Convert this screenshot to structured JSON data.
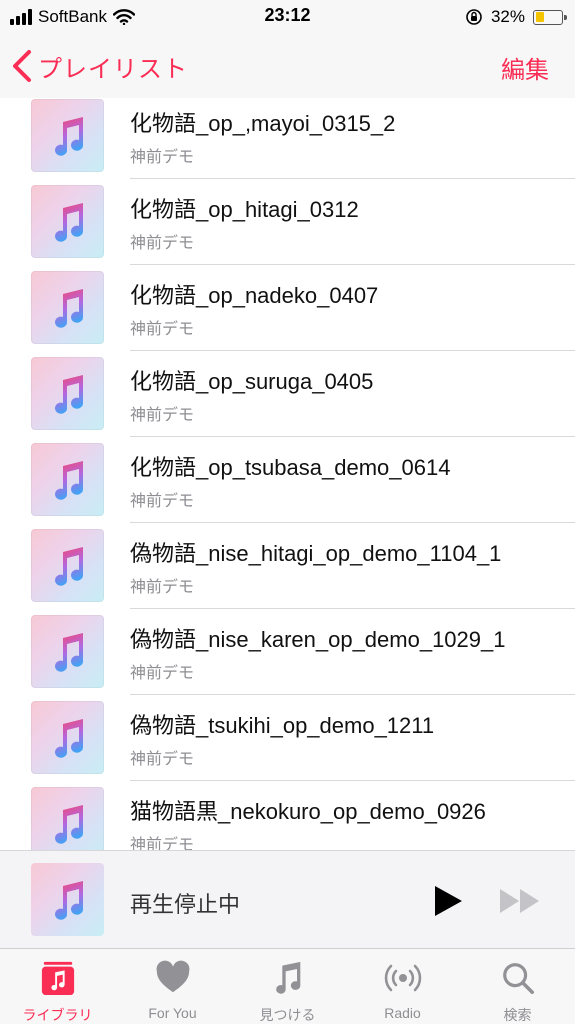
{
  "status_bar": {
    "carrier": "SoftBank",
    "time": "23:12",
    "battery_percent_label": "32%",
    "battery_level": 0.32,
    "battery_color": "#f5c400"
  },
  "nav": {
    "back_label": "プレイリスト",
    "edit_label": "編集",
    "accent_color": "#fa2d55"
  },
  "tracks": [
    {
      "title": "化物語_op_,mayoi_0315_2",
      "artist": "神前デモ"
    },
    {
      "title": "化物語_op_hitagi_0312",
      "artist": "神前デモ"
    },
    {
      "title": "化物語_op_nadeko_0407",
      "artist": "神前デモ"
    },
    {
      "title": "化物語_op_suruga_0405",
      "artist": "神前デモ"
    },
    {
      "title": "化物語_op_tsubasa_demo_0614",
      "artist": "神前デモ"
    },
    {
      "title": "偽物語_nise_hitagi_op_demo_1104_1",
      "artist": "神前デモ"
    },
    {
      "title": "偽物語_nise_karen_op_demo_1029_1",
      "artist": "神前デモ"
    },
    {
      "title": "偽物語_tsukihi_op_demo_1211",
      "artist": "神前デモ"
    },
    {
      "title": "猫物語黒_nekokuro_op_demo_0926",
      "artist": "神前デモ"
    }
  ],
  "mini_player": {
    "title": "再生停止中"
  },
  "tabs": [
    {
      "label": "ライブラリ",
      "icon": "library-icon",
      "active": true
    },
    {
      "label": "For You",
      "icon": "heart-icon",
      "active": false
    },
    {
      "label": "見つける",
      "icon": "music-note-icon",
      "active": false
    },
    {
      "label": "Radio",
      "icon": "radio-icon",
      "active": false
    },
    {
      "label": "検索",
      "icon": "search-icon",
      "active": false
    }
  ]
}
